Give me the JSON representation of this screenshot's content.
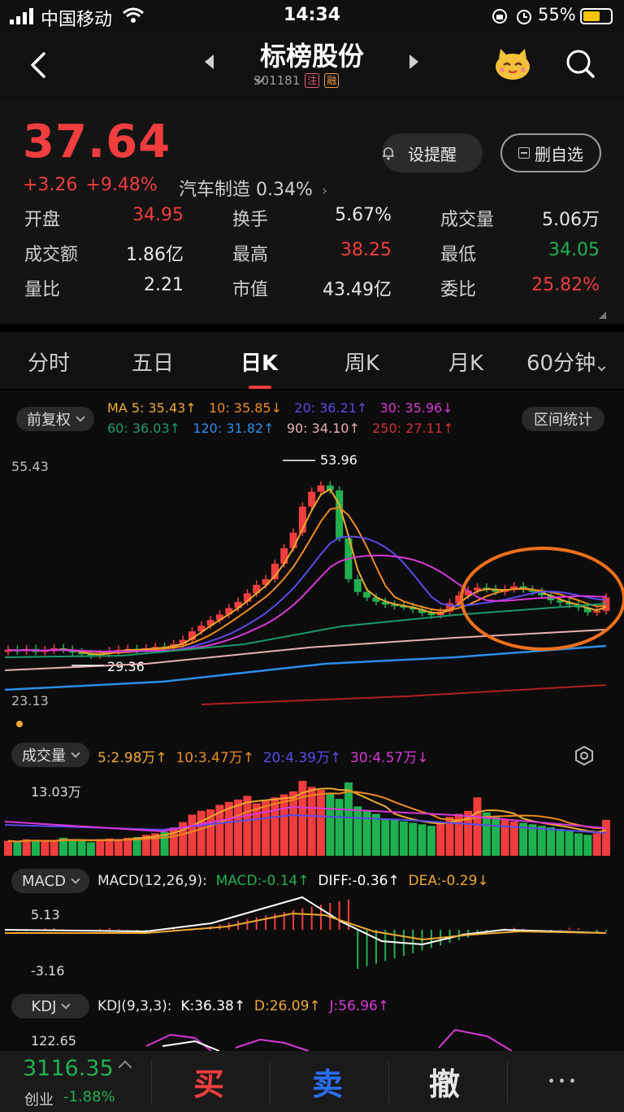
{
  "status": {
    "carrier": "中国移动",
    "time": "14:34",
    "battery": "55%"
  },
  "header": {
    "title": "标榜股份",
    "code": "301181",
    "tag1": "注",
    "tag2": "融"
  },
  "quote": {
    "price": "37.64",
    "change": "+3.26",
    "change_pct": "+9.48%",
    "sector": "汽车制造 0.34%",
    "alert_label": "设提醒",
    "remove_label": "删自选",
    "stats": [
      {
        "k": "开盘",
        "v": "34.95",
        "c": "up"
      },
      {
        "k": "换手",
        "v": "5.67%",
        "c": "wh"
      },
      {
        "k": "成交量",
        "v": "5.06万",
        "c": "wh"
      },
      {
        "k": "成交额",
        "v": "1.86亿",
        "c": "wh"
      },
      {
        "k": "最高",
        "v": "38.25",
        "c": "up"
      },
      {
        "k": "最低",
        "v": "34.05",
        "c": "dn"
      },
      {
        "k": "量比",
        "v": "2.21",
        "c": "wh"
      },
      {
        "k": "市值",
        "v": "43.49亿",
        "c": "wh"
      },
      {
        "k": "委比",
        "v": "25.82%",
        "c": "up"
      }
    ]
  },
  "tabs": [
    "分时",
    "五日",
    "日K",
    "周K",
    "月K",
    "60分钟"
  ],
  "active_tab": "日K",
  "kline": {
    "adjust_label": "前复权",
    "range_label": "区间统计",
    "ma": {
      "ma5": "MA 5: 35.43↑",
      "ma10": "10: 35.85↓",
      "ma20": "20: 36.21↑",
      "ma30": "30: 35.96↓",
      "ma60": "60: 36.03↑",
      "ma120": "120: 31.82↑",
      "ma90": "90: 34.10↑",
      "ma250": "250: 27.11↑"
    },
    "y_high": "55.43",
    "y_low": "23.13",
    "peak_label": "53.96",
    "trough_label": "29.36",
    "colors": {
      "ma5": "#f0a830",
      "ma10": "#f08a20",
      "ma20": "#5a4ae8",
      "ma30": "#d838d8",
      "ma60": "#1a9a6a",
      "ma120": "#2a8ee8",
      "ma90": "#e8b0b0",
      "ma250": "#b02020",
      "up": "#f03d3d",
      "down": "#1fb14f"
    }
  },
  "volume": {
    "label": "成交量",
    "v5": "5:2.98万↑",
    "v10": "10:3.47万↑",
    "v20": "20:4.39万↑",
    "v30": "30:4.57万↓",
    "y_high": "13.03万",
    "y_low": "0"
  },
  "macd": {
    "label": "MACD",
    "params": "MACD(12,26,9):",
    "macd": "MACD:-0.14↑",
    "diff": "DIFF:-0.36↑",
    "dea": "DEA:-0.29↓",
    "y_high": "5.13",
    "y_low": "-3.16"
  },
  "kdj": {
    "label": "KDJ",
    "params": "KDJ(9,3,3):",
    "k": "K:36.38↑",
    "d": "D:26.09↑",
    "j": "J:56.96↑",
    "y_high": "122.65"
  },
  "bottom": {
    "index_value": "3116.35",
    "index_name": "创业",
    "index_change": "-1.88%",
    "buy": "买",
    "sell": "卖",
    "cancel": "撤"
  }
}
